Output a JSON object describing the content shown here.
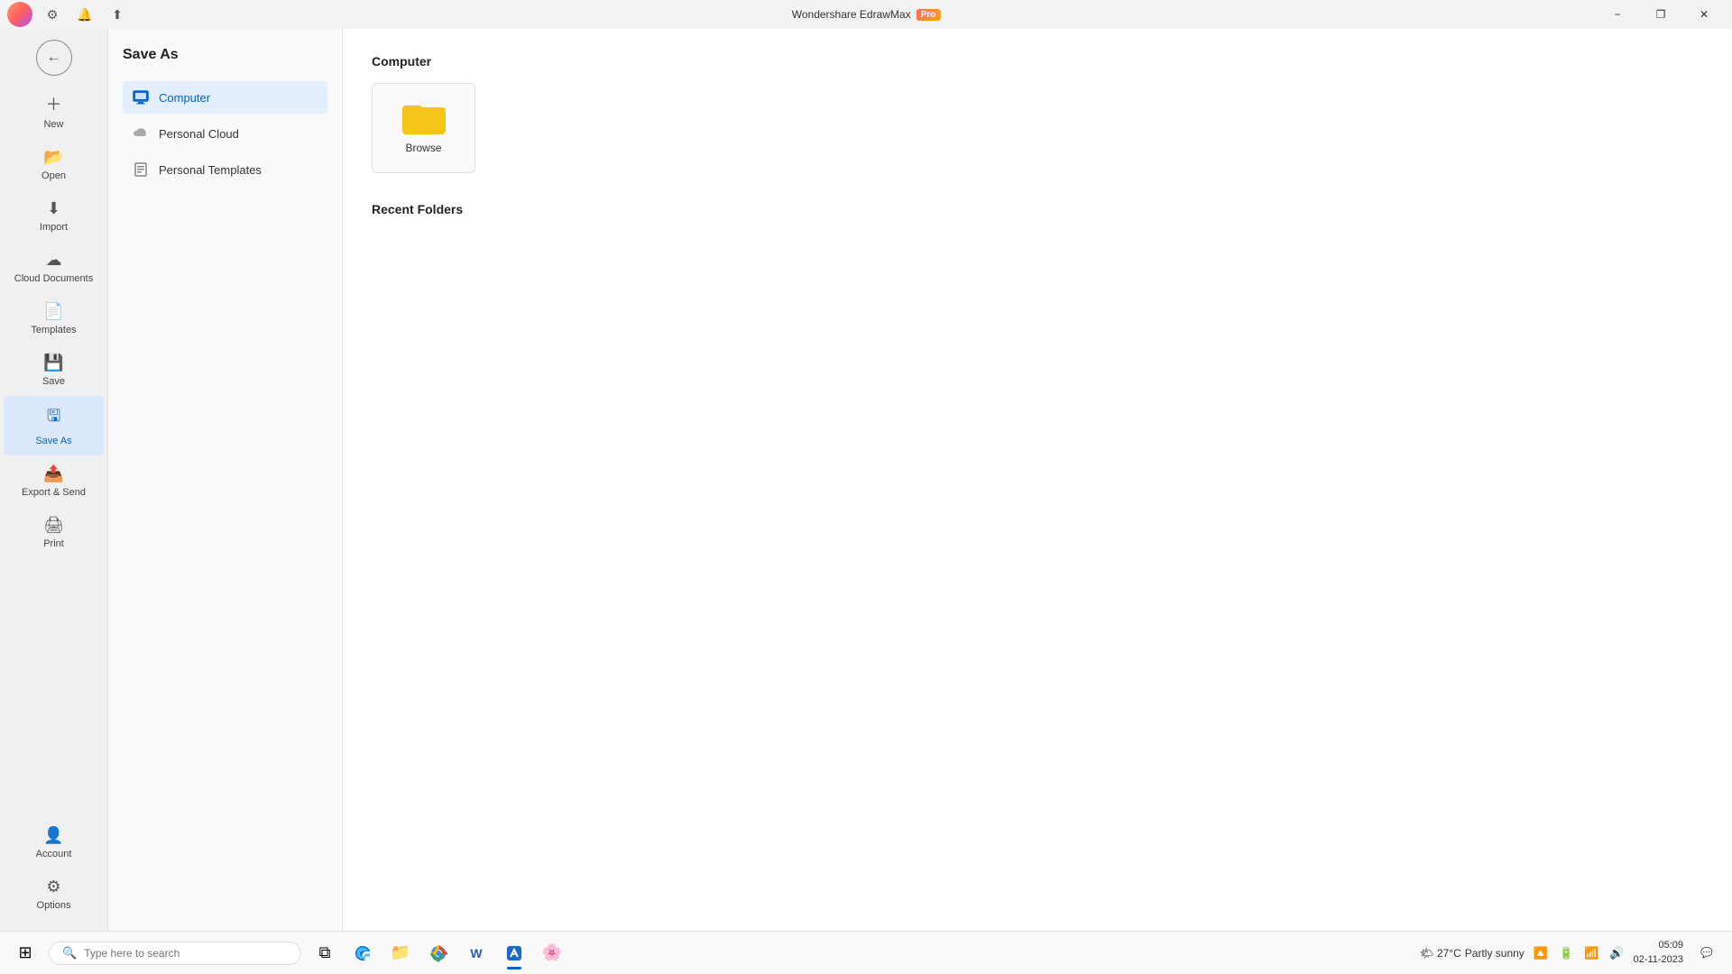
{
  "titlebar": {
    "title": "Wondershare EdrawMax",
    "pro_badge": "Pro",
    "minimize_label": "−",
    "restore_label": "❐",
    "close_label": "✕"
  },
  "sidebar_narrow": {
    "items": [
      {
        "id": "new",
        "label": "New",
        "icon": "+"
      },
      {
        "id": "open",
        "label": "Open",
        "icon": "📂"
      },
      {
        "id": "import",
        "label": "Import",
        "icon": "⬇"
      },
      {
        "id": "cloud-documents",
        "label": "Cloud Documents",
        "icon": "☁"
      },
      {
        "id": "templates",
        "label": "Templates",
        "icon": "📄"
      },
      {
        "id": "save",
        "label": "Save",
        "icon": "💾"
      },
      {
        "id": "save-as",
        "label": "Save As",
        "icon": "🖫"
      },
      {
        "id": "export-send",
        "label": "Export & Send",
        "icon": "📤"
      },
      {
        "id": "print",
        "label": "Print",
        "icon": "🖨"
      }
    ],
    "bottom_items": [
      {
        "id": "account",
        "label": "Account",
        "icon": "👤"
      },
      {
        "id": "options",
        "label": "Options",
        "icon": "⚙"
      }
    ]
  },
  "middle_panel": {
    "title": "Save As",
    "options": [
      {
        "id": "computer",
        "label": "Computer",
        "icon": "computer",
        "active": true
      },
      {
        "id": "personal-cloud",
        "label": "Personal Cloud",
        "icon": "cloud",
        "active": false
      },
      {
        "id": "personal-templates",
        "label": "Personal Templates",
        "icon": "template",
        "active": false
      }
    ]
  },
  "main_content": {
    "computer_section": {
      "title": "Computer",
      "browse_label": "Browse"
    },
    "recent_folders": {
      "title": "Recent Folders"
    }
  },
  "taskbar": {
    "start_icon": "⊞",
    "search_placeholder": "Type here to search",
    "apps": [
      {
        "id": "task-view",
        "icon": "⧉",
        "active": false
      },
      {
        "id": "edge",
        "icon": "🌐",
        "active": false
      },
      {
        "id": "file-explorer",
        "icon": "📁",
        "active": false
      },
      {
        "id": "chrome",
        "icon": "🔵",
        "active": false
      },
      {
        "id": "word",
        "icon": "W",
        "active": false
      },
      {
        "id": "edraw",
        "icon": "📊",
        "active": true
      }
    ],
    "weather": {
      "icon": "🌤",
      "temp": "27°C",
      "condition": "Partly sunny"
    },
    "time": "05:09",
    "date": "02-11-2023",
    "sys_icons": [
      "🔼",
      "🔔",
      "📶",
      "🔊"
    ]
  },
  "colors": {
    "active_blue": "#0066cc",
    "active_bg": "#e3eeff",
    "sidebar_bg": "#f0f0f0",
    "folder_yellow": "#f5c518"
  }
}
